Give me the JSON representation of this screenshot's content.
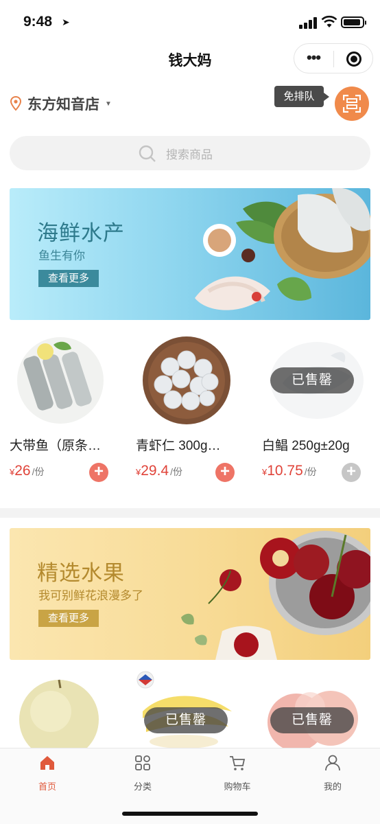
{
  "status_bar": {
    "time": "9:48"
  },
  "nav": {
    "title": "钱大妈"
  },
  "store": {
    "name": "东方知音店"
  },
  "queue_tip": "免排队",
  "search": {
    "placeholder": "搜索商品"
  },
  "banners": [
    {
      "title": "海鲜水产",
      "subtitle": "鱼生有你",
      "more": "查看更多"
    },
    {
      "title": "精选水果",
      "subtitle": "我可别鲜花浪漫多了",
      "more": "查看更多"
    }
  ],
  "seafood": [
    {
      "name": "大带鱼（原条…",
      "currency": "¥",
      "price": "26",
      "unit": "/份",
      "sold_out": false
    },
    {
      "name": "青虾仁 300g…",
      "currency": "¥",
      "price": "29.4",
      "unit": "/份",
      "sold_out": false
    },
    {
      "name": "白鲳 250g±20g",
      "currency": "¥",
      "price": "10.75",
      "unit": "/份",
      "sold_out": true
    }
  ],
  "sold_out_label": "已售罄",
  "tabs": [
    {
      "label": "首页",
      "icon": "home-icon",
      "active": true
    },
    {
      "label": "分类",
      "icon": "grid-icon",
      "active": false
    },
    {
      "label": "购物车",
      "icon": "cart-icon",
      "active": false
    },
    {
      "label": "我的",
      "icon": "user-icon",
      "active": false
    }
  ],
  "colors": {
    "accent": "#e05a3c",
    "price": "#e0443a",
    "scan": "#f08a4b"
  }
}
